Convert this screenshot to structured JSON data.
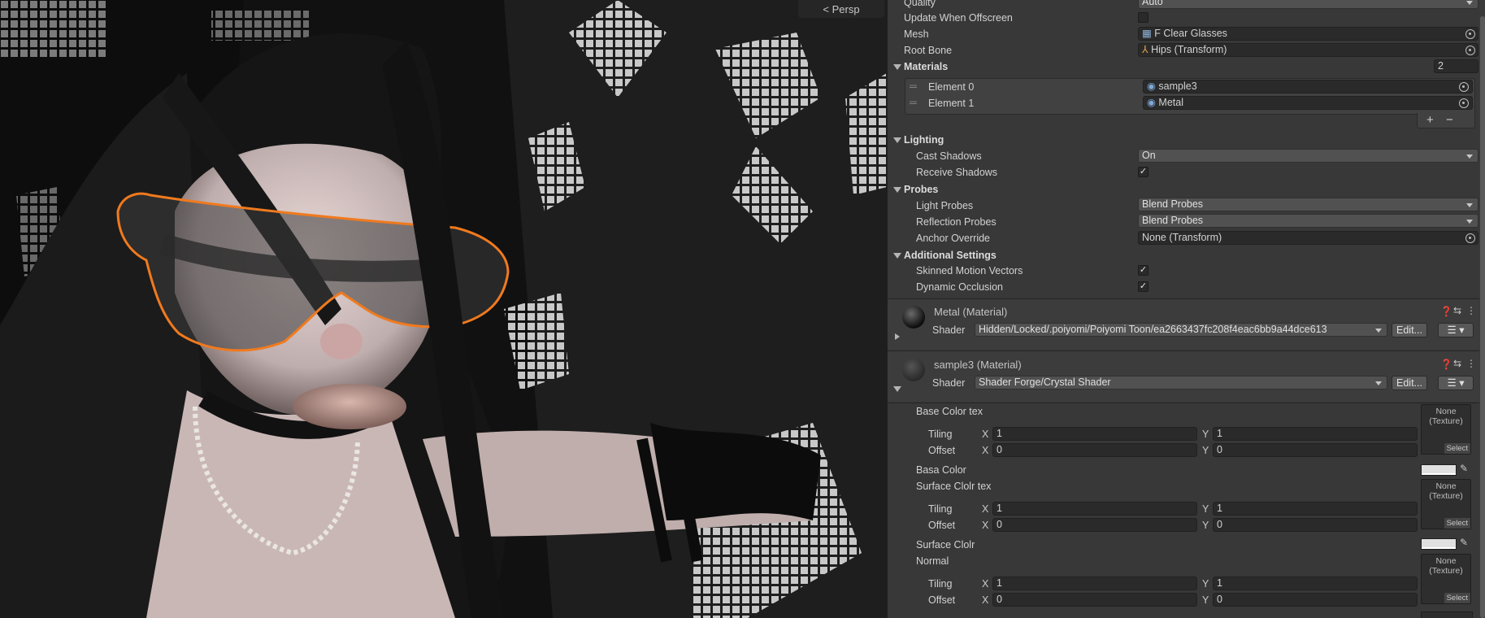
{
  "viewport": {
    "persp_label": "< Persp",
    "highlight_color": "#f07a1e"
  },
  "inspector": {
    "top_fields": {
      "quality_label": "Quality",
      "quality_value": "Auto",
      "update_offscreen_label": "Update When Offscreen",
      "mesh_label": "Mesh",
      "mesh_value": "F Clear Glasses",
      "root_bone_label": "Root Bone",
      "root_bone_value": "Hips (Transform)"
    },
    "materials": {
      "header": "Materials",
      "count": "2",
      "elements": [
        {
          "label": "Element 0",
          "value": "sample3"
        },
        {
          "label": "Element 1",
          "value": "Metal"
        }
      ],
      "add": "+",
      "remove": "−"
    },
    "lighting": {
      "header": "Lighting",
      "cast_shadows_label": "Cast Shadows",
      "cast_shadows_value": "On",
      "receive_shadows_label": "Receive Shadows",
      "receive_shadows_checked": true
    },
    "probes": {
      "header": "Probes",
      "light_probes_label": "Light Probes",
      "light_probes_value": "Blend Probes",
      "reflection_probes_label": "Reflection Probes",
      "reflection_probes_value": "Blend Probes",
      "anchor_override_label": "Anchor Override",
      "anchor_override_value": "None (Transform)"
    },
    "additional": {
      "header": "Additional Settings",
      "skinned_motion_label": "Skinned Motion Vectors",
      "skinned_motion_checked": true,
      "dynamic_occlusion_label": "Dynamic Occlusion",
      "dynamic_occlusion_checked": true
    },
    "metal_material": {
      "title": "Metal (Material)",
      "shader_label": "Shader",
      "shader_value": "Hidden/Locked/.poiyomi/Poiyomi Toon/ea2663437fc208f4eac6bb9a44dce613",
      "edit_label": "Edit..."
    },
    "sample3_material": {
      "title": "sample3 (Material)",
      "shader_label": "Shader",
      "shader_value": "Shader Forge/Crystal Shader",
      "edit_label": "Edit...",
      "props": {
        "base_color_tex": "Base Color tex",
        "base_color": "Basa Color",
        "surface_color_tex": "Surface Clolr tex",
        "surface_color": "Surface Clolr",
        "normal": "Normal",
        "tiling": "Tiling",
        "offset": "Offset",
        "x": "X",
        "y": "Y",
        "tiling_x": "1",
        "tiling_y": "1",
        "offset_x": "0",
        "offset_y": "0",
        "texture_none": "None\n(Texture)",
        "select": "Select"
      }
    }
  }
}
